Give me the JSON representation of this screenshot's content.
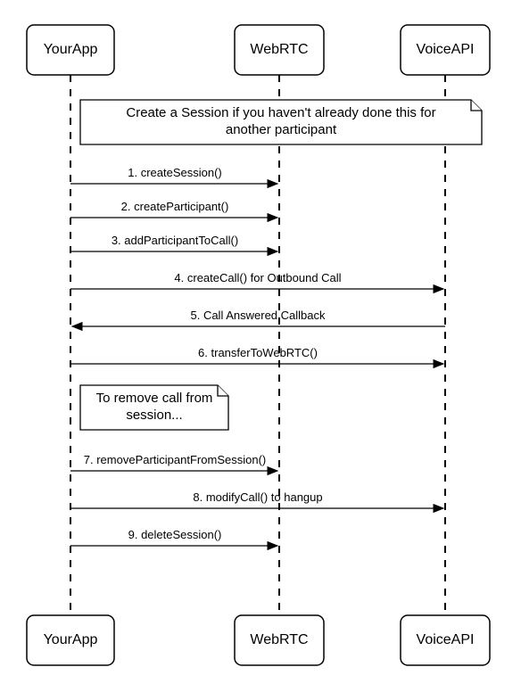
{
  "diagram": {
    "type": "sequence",
    "participants": [
      {
        "id": "yourapp",
        "label": "YourApp"
      },
      {
        "id": "webrtc",
        "label": "WebRTC"
      },
      {
        "id": "voiceapi",
        "label": "VoiceAPI"
      }
    ],
    "notes": [
      {
        "id": "n1",
        "text_line1": "Create a Session if you haven't already done this for",
        "text_line2": "another participant"
      },
      {
        "id": "n2",
        "text_line1": "To remove call from",
        "text_line2": "session..."
      }
    ],
    "messages": [
      {
        "num": 1,
        "from": "yourapp",
        "to": "webrtc",
        "label": "1. createSession()"
      },
      {
        "num": 2,
        "from": "yourapp",
        "to": "webrtc",
        "label": "2. createParticipant()"
      },
      {
        "num": 3,
        "from": "yourapp",
        "to": "webrtc",
        "label": "3. addParticipantToCall()"
      },
      {
        "num": 4,
        "from": "yourapp",
        "to": "voiceapi",
        "label": "4. createCall() for Outbound Call"
      },
      {
        "num": 5,
        "from": "voiceapi",
        "to": "yourapp",
        "label": "5. Call Answered Callback"
      },
      {
        "num": 6,
        "from": "yourapp",
        "to": "voiceapi",
        "label": "6. transferToWebRTC()"
      },
      {
        "num": 7,
        "from": "yourapp",
        "to": "webrtc",
        "label": "7. removeParticipantFromSession()"
      },
      {
        "num": 8,
        "from": "yourapp",
        "to": "voiceapi",
        "label": "8. modifyCall() to hangup"
      },
      {
        "num": 9,
        "from": "yourapp",
        "to": "webrtc",
        "label": "9. deleteSession()"
      }
    ]
  }
}
